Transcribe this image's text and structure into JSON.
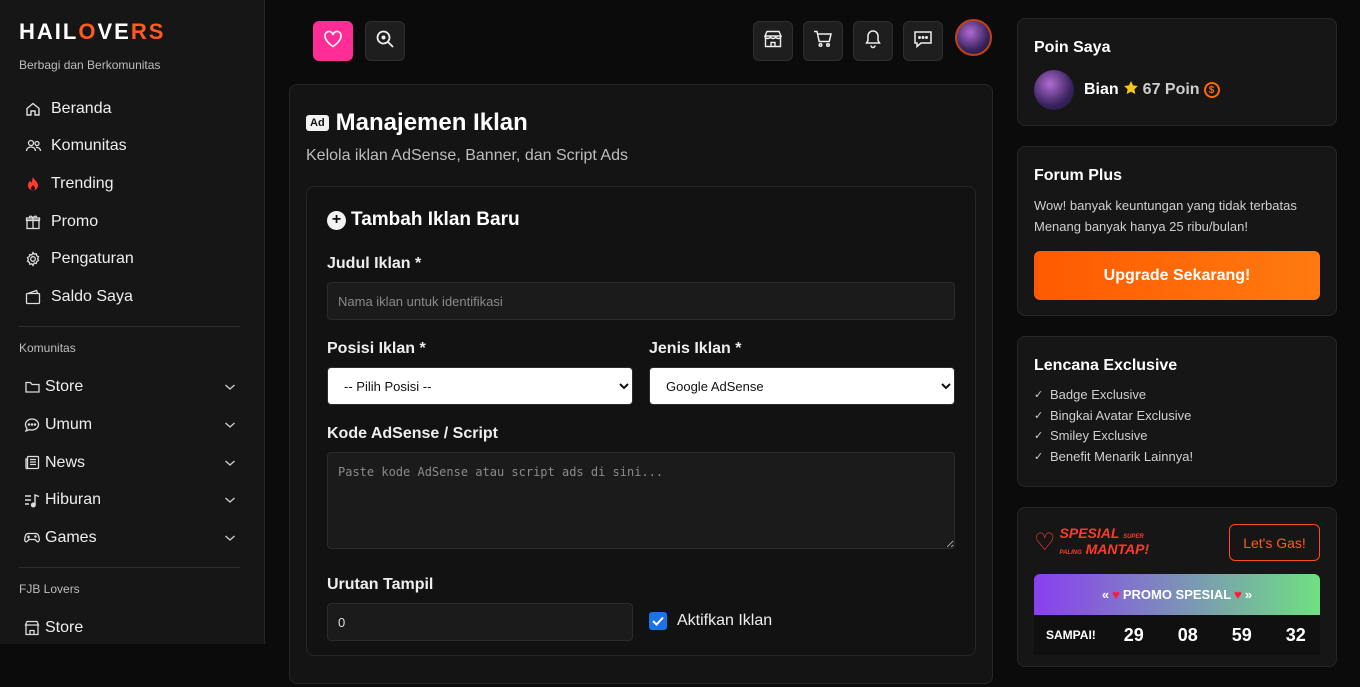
{
  "sidebar": {
    "logo": {
      "part1": "HAIL",
      "o": "O",
      "part2": "VE",
      "part3": "RS"
    },
    "tagline": "Berbagi dan Berkomunitas",
    "nav": [
      {
        "label": "Beranda",
        "icon": "home-icon"
      },
      {
        "label": "Komunitas",
        "icon": "users-icon"
      },
      {
        "label": "Trending",
        "icon": "fire-icon"
      },
      {
        "label": "Promo",
        "icon": "gift-icon"
      },
      {
        "label": "Pengaturan",
        "icon": "gear-icon"
      },
      {
        "label": "Saldo Saya",
        "icon": "wallet-icon"
      }
    ],
    "komunitas_label": "Komunitas",
    "komunitas": [
      {
        "label": "Store",
        "icon": "folder-icon"
      },
      {
        "label": "Umum",
        "icon": "chat-icon"
      },
      {
        "label": "News",
        "icon": "newspaper-icon"
      },
      {
        "label": "Hiburan",
        "icon": "music-icon"
      },
      {
        "label": "Games",
        "icon": "gamepad-icon"
      }
    ],
    "fjb_label": "FJB Lovers",
    "fjb": [
      {
        "label": "Store",
        "icon": "shop-icon"
      }
    ]
  },
  "main": {
    "badge": "Ad",
    "title": "Manajemen Iklan",
    "subtitle": "Kelola iklan AdSense, Banner, dan Script Ads",
    "form": {
      "title": "Tambah Iklan Baru",
      "judul_label": "Judul Iklan *",
      "judul_placeholder": "Nama iklan untuk identifikasi",
      "posisi_label": "Posisi Iklan *",
      "posisi_value": "-- Pilih Posisi --",
      "jenis_label": "Jenis Iklan *",
      "jenis_value": "Google AdSense",
      "kode_label": "Kode AdSense / Script",
      "kode_placeholder": "Paste kode AdSense atau script ads di sini...",
      "urutan_label": "Urutan Tampil",
      "urutan_value": "0",
      "aktif_label": "Aktifkan Iklan"
    }
  },
  "right": {
    "poin": {
      "title": "Poin Saya",
      "name": "Bian",
      "value": "67 Poin"
    },
    "forum": {
      "title": "Forum Plus",
      "line1": "Wow! banyak keuntungan yang tidak terbatas",
      "line2": "Menang banyak hanya 25 ribu/bulan!",
      "button": "Upgrade Sekarang!"
    },
    "lencana": {
      "title": "Lencana Exclusive",
      "items": [
        "Badge Exclusive",
        "Bingkai Avatar Exclusive",
        "Smiley Exclusive",
        "Benefit Menarik Lainnya!"
      ]
    },
    "promo": {
      "logo_top": "SPESIAL",
      "logo_small_top": "SUPER",
      "logo_small_bottom": "PALING",
      "logo_bottom": "MANTAP!",
      "button": "Let's Gas!",
      "banner_left": "«",
      "banner_text": "PROMO SPESIAL",
      "banner_right": "»",
      "countdown_label": "SAMPAI!",
      "countdown": [
        "29",
        "08",
        "59",
        "32"
      ]
    }
  },
  "colors": {
    "accent": "#ff5a1f",
    "pink": "#ff2d95",
    "checkbox": "#1a73e8"
  }
}
